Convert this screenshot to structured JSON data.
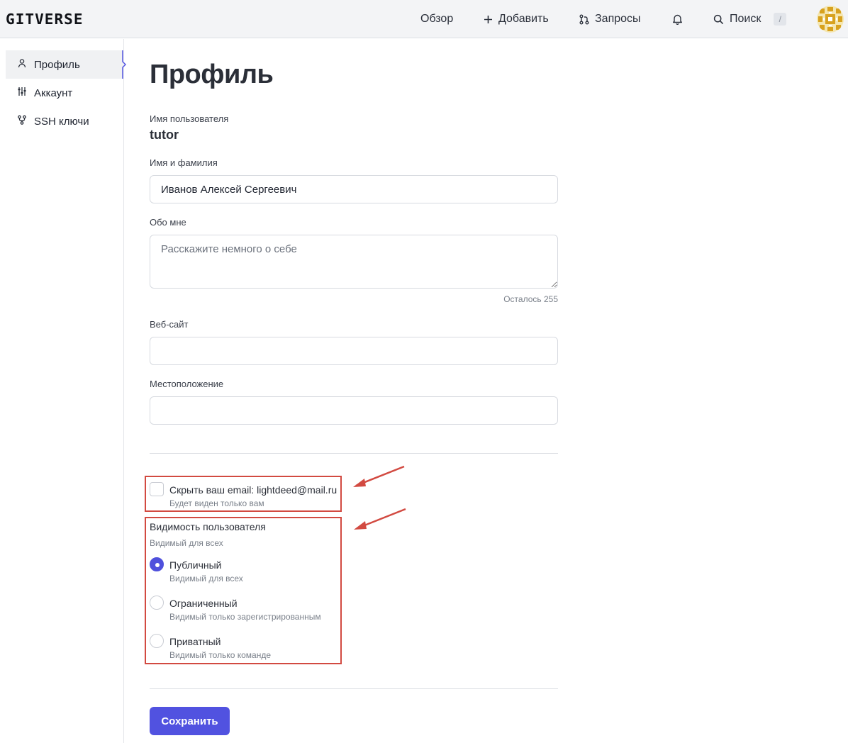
{
  "header": {
    "logo": "GITVERSE",
    "nav": {
      "overview": "Обзор",
      "add": "Добавить",
      "requests": "Запросы",
      "search": "Поиск",
      "search_shortcut": "/"
    }
  },
  "sidebar": {
    "items": [
      {
        "label": "Профиль",
        "icon": "user-icon",
        "active": true
      },
      {
        "label": "Аккаунт",
        "icon": "sliders-icon",
        "active": false
      },
      {
        "label": "SSH ключи",
        "icon": "key-branch-icon",
        "active": false
      }
    ]
  },
  "main": {
    "title": "Профиль",
    "username_label": "Имя пользователя",
    "username": "tutor",
    "fullname_label": "Имя и фамилия",
    "fullname_value": "Иванов Алексей Сергеевич",
    "about_label": "Обо мне",
    "about_placeholder": "Расскажите немного о себе",
    "about_counter": "Осталось 255",
    "website_label": "Веб-сайт",
    "website_value": "",
    "location_label": "Местоположение",
    "location_value": "",
    "hide_email_label": "Скрыть ваш email: lightdeed@mail.ru",
    "hide_email_hint": "Будет виден только вам",
    "visibility_label": "Видимость пользователя",
    "visibility_current": "Видимый для всех",
    "visibility_options": [
      {
        "label": "Публичный",
        "hint": "Видимый для всех",
        "checked": true
      },
      {
        "label": "Ограниченный",
        "hint": "Видимый только зарегистрированным",
        "checked": false
      },
      {
        "label": "Приватный",
        "hint": "Видимый только команде",
        "checked": false
      }
    ],
    "save_label": "Сохранить"
  },
  "colors": {
    "accent": "#5152e0",
    "annotation": "#d24a41",
    "header_bg": "#f3f4f6"
  }
}
